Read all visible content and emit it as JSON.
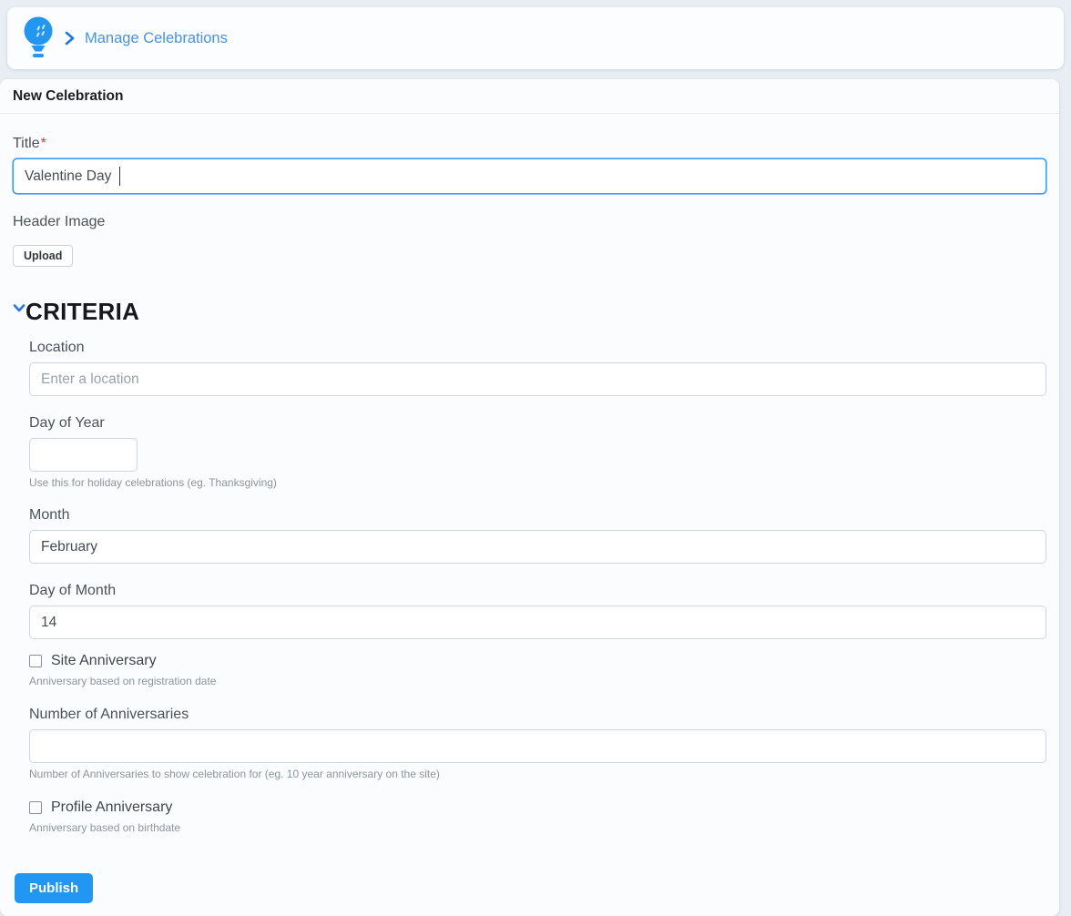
{
  "breadcrumb": {
    "link_label": "Manage Celebrations"
  },
  "page": {
    "title": "New Celebration"
  },
  "form": {
    "title": {
      "label": "Title",
      "required_mark": "*",
      "value": "Valentine Day"
    },
    "header_image": {
      "label": "Header Image",
      "upload_label": "Upload"
    },
    "criteria": {
      "heading": "CRITERIA",
      "location": {
        "label": "Location",
        "placeholder": "Enter a location",
        "value": ""
      },
      "day_of_year": {
        "label": "Day of Year",
        "value": "",
        "help": "Use this for holiday celebrations (eg. Thanksgiving)"
      },
      "month": {
        "label": "Month",
        "value": "February"
      },
      "day_of_month": {
        "label": "Day of Month",
        "value": "14"
      },
      "site_anniversary": {
        "label": "Site Anniversary",
        "checked": false,
        "help": "Anniversary based on registration date"
      },
      "number_of_anniversaries": {
        "label": "Number of Anniversaries",
        "value": "",
        "help": "Number of Anniversaries to show celebration for (eg. 10 year anniversary on the site)"
      },
      "profile_anniversary": {
        "label": "Profile Anniversary",
        "checked": false,
        "help": "Anniversary based on birthdate"
      }
    },
    "publish_label": "Publish"
  },
  "colors": {
    "accent": "#2196f3",
    "link": "#4592f0",
    "focus_border": "#3f9cf5",
    "required": "#dc3545",
    "page_background": "#e8eef4",
    "card_background": "#fafcfd"
  }
}
